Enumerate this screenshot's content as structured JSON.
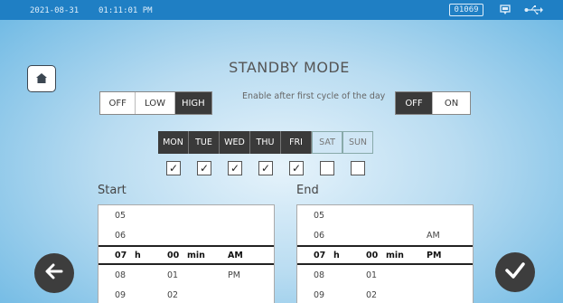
{
  "status": {
    "date": "2021-08-31",
    "time": "01:11:01 PM",
    "counter": "01069"
  },
  "title": "STANDBY MODE",
  "mode": {
    "options": [
      "OFF",
      "LOW",
      "HIGH"
    ],
    "selected": "HIGH"
  },
  "first_cycle": {
    "label": "Enable after first cycle of the day",
    "options": [
      "OFF",
      "ON"
    ],
    "selected": "OFF"
  },
  "days": [
    {
      "label": "MON",
      "active": true,
      "checked": true
    },
    {
      "label": "TUE",
      "active": true,
      "checked": true
    },
    {
      "label": "WED",
      "active": true,
      "checked": true
    },
    {
      "label": "THU",
      "active": true,
      "checked": true
    },
    {
      "label": "FRI",
      "active": true,
      "checked": true
    },
    {
      "label": "SAT",
      "active": false,
      "checked": false
    },
    {
      "label": "SUN",
      "active": false,
      "checked": false
    }
  ],
  "check_mark": "✓",
  "start": {
    "label": "Start",
    "rows": [
      {
        "hour": "05",
        "h": "",
        "min": "",
        "m": "",
        "ampm": ""
      },
      {
        "hour": "06",
        "h": "",
        "min": "",
        "m": "",
        "ampm": ""
      },
      {
        "hour": "07",
        "h": "h",
        "min": "00",
        "m": "min",
        "ampm": "AM"
      },
      {
        "hour": "08",
        "h": "",
        "min": "01",
        "m": "",
        "ampm": "PM"
      },
      {
        "hour": "09",
        "h": "",
        "min": "02",
        "m": "",
        "ampm": ""
      }
    ]
  },
  "end": {
    "label": "End",
    "rows": [
      {
        "hour": "05",
        "h": "",
        "min": "",
        "m": "",
        "ampm": ""
      },
      {
        "hour": "06",
        "h": "",
        "min": "",
        "m": "",
        "ampm": "AM"
      },
      {
        "hour": "07",
        "h": "h",
        "min": "00",
        "m": "min",
        "ampm": "PM"
      },
      {
        "hour": "08",
        "h": "",
        "min": "01",
        "m": "",
        "ampm": ""
      },
      {
        "hour": "09",
        "h": "",
        "min": "02",
        "m": "",
        "ampm": ""
      }
    ]
  },
  "colors": {
    "statusbar": "#1f7fc4",
    "selected_segment": "#3a3a3a",
    "round_button": "#3d3d3d"
  },
  "icons": {
    "home": "home-icon",
    "chat": "chat-icon",
    "usb": "usb-icon",
    "back": "arrow-left-icon",
    "confirm": "checkmark-icon"
  }
}
